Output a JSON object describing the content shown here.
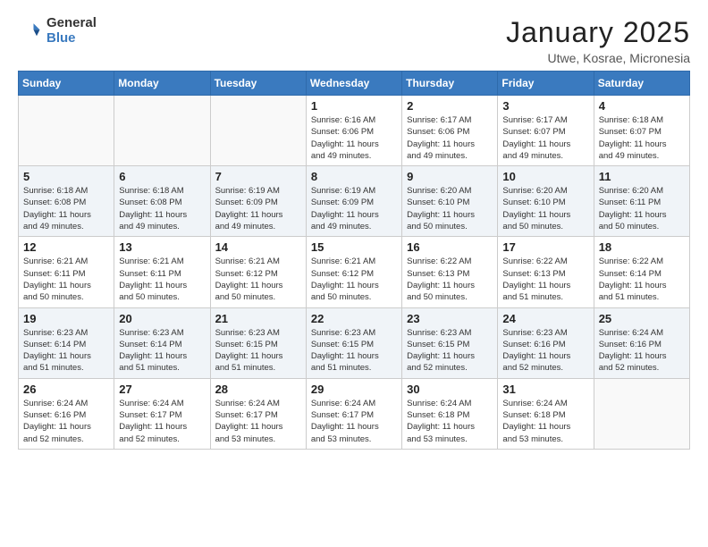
{
  "logo": {
    "general": "General",
    "blue": "Blue"
  },
  "header": {
    "month": "January 2025",
    "location": "Utwe, Kosrae, Micronesia"
  },
  "weekdays": [
    "Sunday",
    "Monday",
    "Tuesday",
    "Wednesday",
    "Thursday",
    "Friday",
    "Saturday"
  ],
  "weeks": [
    [
      {
        "day": "",
        "info": ""
      },
      {
        "day": "",
        "info": ""
      },
      {
        "day": "",
        "info": ""
      },
      {
        "day": "1",
        "info": "Sunrise: 6:16 AM\nSunset: 6:06 PM\nDaylight: 11 hours\nand 49 minutes."
      },
      {
        "day": "2",
        "info": "Sunrise: 6:17 AM\nSunset: 6:06 PM\nDaylight: 11 hours\nand 49 minutes."
      },
      {
        "day": "3",
        "info": "Sunrise: 6:17 AM\nSunset: 6:07 PM\nDaylight: 11 hours\nand 49 minutes."
      },
      {
        "day": "4",
        "info": "Sunrise: 6:18 AM\nSunset: 6:07 PM\nDaylight: 11 hours\nand 49 minutes."
      }
    ],
    [
      {
        "day": "5",
        "info": "Sunrise: 6:18 AM\nSunset: 6:08 PM\nDaylight: 11 hours\nand 49 minutes."
      },
      {
        "day": "6",
        "info": "Sunrise: 6:18 AM\nSunset: 6:08 PM\nDaylight: 11 hours\nand 49 minutes."
      },
      {
        "day": "7",
        "info": "Sunrise: 6:19 AM\nSunset: 6:09 PM\nDaylight: 11 hours\nand 49 minutes."
      },
      {
        "day": "8",
        "info": "Sunrise: 6:19 AM\nSunset: 6:09 PM\nDaylight: 11 hours\nand 49 minutes."
      },
      {
        "day": "9",
        "info": "Sunrise: 6:20 AM\nSunset: 6:10 PM\nDaylight: 11 hours\nand 50 minutes."
      },
      {
        "day": "10",
        "info": "Sunrise: 6:20 AM\nSunset: 6:10 PM\nDaylight: 11 hours\nand 50 minutes."
      },
      {
        "day": "11",
        "info": "Sunrise: 6:20 AM\nSunset: 6:11 PM\nDaylight: 11 hours\nand 50 minutes."
      }
    ],
    [
      {
        "day": "12",
        "info": "Sunrise: 6:21 AM\nSunset: 6:11 PM\nDaylight: 11 hours\nand 50 minutes."
      },
      {
        "day": "13",
        "info": "Sunrise: 6:21 AM\nSunset: 6:11 PM\nDaylight: 11 hours\nand 50 minutes."
      },
      {
        "day": "14",
        "info": "Sunrise: 6:21 AM\nSunset: 6:12 PM\nDaylight: 11 hours\nand 50 minutes."
      },
      {
        "day": "15",
        "info": "Sunrise: 6:21 AM\nSunset: 6:12 PM\nDaylight: 11 hours\nand 50 minutes."
      },
      {
        "day": "16",
        "info": "Sunrise: 6:22 AM\nSunset: 6:13 PM\nDaylight: 11 hours\nand 50 minutes."
      },
      {
        "day": "17",
        "info": "Sunrise: 6:22 AM\nSunset: 6:13 PM\nDaylight: 11 hours\nand 51 minutes."
      },
      {
        "day": "18",
        "info": "Sunrise: 6:22 AM\nSunset: 6:14 PM\nDaylight: 11 hours\nand 51 minutes."
      }
    ],
    [
      {
        "day": "19",
        "info": "Sunrise: 6:23 AM\nSunset: 6:14 PM\nDaylight: 11 hours\nand 51 minutes."
      },
      {
        "day": "20",
        "info": "Sunrise: 6:23 AM\nSunset: 6:14 PM\nDaylight: 11 hours\nand 51 minutes."
      },
      {
        "day": "21",
        "info": "Sunrise: 6:23 AM\nSunset: 6:15 PM\nDaylight: 11 hours\nand 51 minutes."
      },
      {
        "day": "22",
        "info": "Sunrise: 6:23 AM\nSunset: 6:15 PM\nDaylight: 11 hours\nand 51 minutes."
      },
      {
        "day": "23",
        "info": "Sunrise: 6:23 AM\nSunset: 6:15 PM\nDaylight: 11 hours\nand 52 minutes."
      },
      {
        "day": "24",
        "info": "Sunrise: 6:23 AM\nSunset: 6:16 PM\nDaylight: 11 hours\nand 52 minutes."
      },
      {
        "day": "25",
        "info": "Sunrise: 6:24 AM\nSunset: 6:16 PM\nDaylight: 11 hours\nand 52 minutes."
      }
    ],
    [
      {
        "day": "26",
        "info": "Sunrise: 6:24 AM\nSunset: 6:16 PM\nDaylight: 11 hours\nand 52 minutes."
      },
      {
        "day": "27",
        "info": "Sunrise: 6:24 AM\nSunset: 6:17 PM\nDaylight: 11 hours\nand 52 minutes."
      },
      {
        "day": "28",
        "info": "Sunrise: 6:24 AM\nSunset: 6:17 PM\nDaylight: 11 hours\nand 53 minutes."
      },
      {
        "day": "29",
        "info": "Sunrise: 6:24 AM\nSunset: 6:17 PM\nDaylight: 11 hours\nand 53 minutes."
      },
      {
        "day": "30",
        "info": "Sunrise: 6:24 AM\nSunset: 6:18 PM\nDaylight: 11 hours\nand 53 minutes."
      },
      {
        "day": "31",
        "info": "Sunrise: 6:24 AM\nSunset: 6:18 PM\nDaylight: 11 hours\nand 53 minutes."
      },
      {
        "day": "",
        "info": ""
      }
    ]
  ]
}
